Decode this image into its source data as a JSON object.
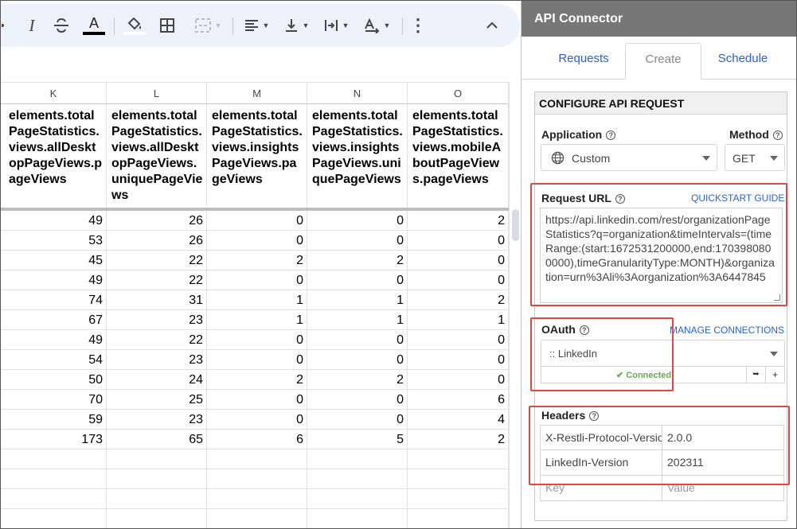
{
  "toolbar": {
    "icons": [
      "italic-icon",
      "strikethrough-icon",
      "text-color-icon",
      "fill-color-icon",
      "borders-icon",
      "merge-cells-icon",
      "horizontal-align-icon",
      "vertical-align-icon",
      "text-wrapping-icon",
      "text-rotation-icon",
      "more-vert-icon",
      "chevron-up-icon"
    ],
    "italic": "I",
    "text_color": "A",
    "more": "⋮",
    "collapse": "⌃"
  },
  "sheet": {
    "columns": [
      "K",
      "L",
      "M",
      "N",
      "O"
    ],
    "headers": [
      "elements.totalPageStatistics.views.allDesktopPageViews.pageViews",
      "elements.totalPageStatistics.views.allDesktopPageViews.uniquePageViews",
      "elements.totalPageStatistics.views.insightsPageViews.pageViews",
      "elements.totalPageStatistics.views.insightsPageViews.uniquePageViews",
      "elements.totalPageStatistics.views.mobileAboutPageViews.pageViews"
    ],
    "rows": [
      [
        "49",
        "26",
        "0",
        "0",
        "2"
      ],
      [
        "53",
        "26",
        "0",
        "0",
        "0"
      ],
      [
        "45",
        "22",
        "2",
        "2",
        "0"
      ],
      [
        "49",
        "22",
        "0",
        "0",
        "0"
      ],
      [
        "74",
        "31",
        "1",
        "1",
        "2"
      ],
      [
        "67",
        "23",
        "1",
        "1",
        "1"
      ],
      [
        "49",
        "22",
        "0",
        "0",
        "0"
      ],
      [
        "54",
        "23",
        "0",
        "0",
        "0"
      ],
      [
        "50",
        "24",
        "2",
        "2",
        "0"
      ],
      [
        "70",
        "25",
        "0",
        "0",
        "6"
      ],
      [
        "59",
        "23",
        "0",
        "0",
        "4"
      ],
      [
        "173",
        "65",
        "6",
        "5",
        "2"
      ],
      [
        "",
        "",
        "",
        "",
        ""
      ],
      [
        "",
        "",
        "",
        "",
        ""
      ],
      [
        "",
        "",
        "",
        "",
        ""
      ],
      [
        "",
        "",
        "",
        "",
        ""
      ]
    ]
  },
  "panel": {
    "title": "API Connector",
    "tabs": [
      "Requests",
      "Create",
      "Schedule"
    ],
    "active_tab": "Create",
    "section_title": "CONFIGURE API REQUEST",
    "application_label": "Application",
    "application_value": "Custom",
    "method_label": "Method",
    "method_value": "GET",
    "request_url_label": "Request URL",
    "quickstart_link": "QUICKSTART GUIDE",
    "request_url": "https://api.linkedin.com/rest/organizationPageStatistics?q=organization&timeIntervals=(timeRange:(start:1672531200000,end:1703980800000),timeGranularityType:MONTH)&organization=urn%3Ali%3Aorganization%3A6447845",
    "oauth_label": "OAuth",
    "manage_link": "MANAGE CONNECTIONS",
    "oauth_value": ":: LinkedIn",
    "connected_text": "Connected",
    "headers_label": "Headers",
    "headers": [
      {
        "key": "X-Restli-Protocol-Version",
        "value": "2.0.0"
      },
      {
        "key": "LinkedIn-Version",
        "value": "202311"
      }
    ],
    "key_placeholder": "Key",
    "value_placeholder": "Value"
  },
  "colors": {
    "panel_title_bg": "#777777",
    "link": "#2a62c9",
    "highlight": "#e5453f",
    "toolbar_bg": "#edf2fa"
  }
}
